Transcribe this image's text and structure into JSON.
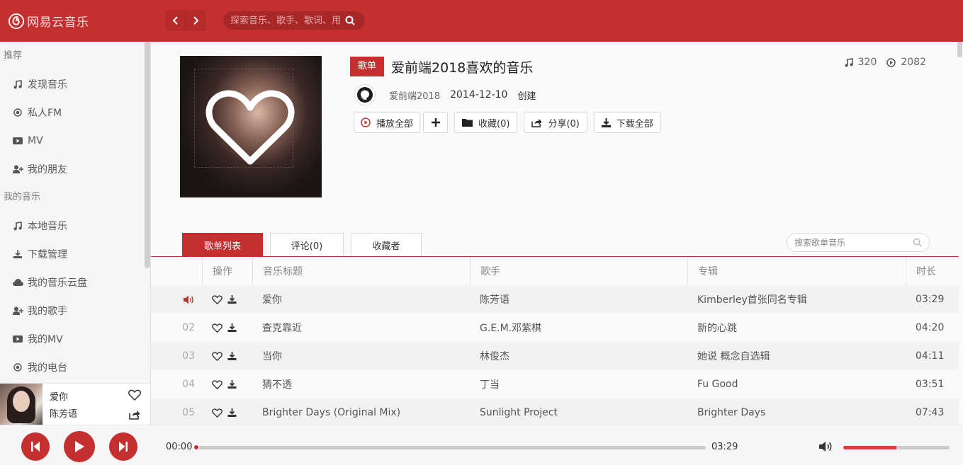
{
  "app": {
    "title": "网易云音乐",
    "brand_color": "#c62f2f"
  },
  "topbar": {
    "search_placeholder": "探索音乐、歌手、歌词、用"
  },
  "sidebar": {
    "sections": [
      {
        "title": "推荐",
        "items": [
          {
            "label": "发现音乐",
            "icon": "music-note-icon"
          },
          {
            "label": "私人FM",
            "icon": "radio-icon"
          },
          {
            "label": "MV",
            "icon": "video-icon"
          },
          {
            "label": "我的朋友",
            "icon": "add-friend-icon"
          }
        ]
      },
      {
        "title": "我的音乐",
        "items": [
          {
            "label": "本地音乐",
            "icon": "music-note-icon"
          },
          {
            "label": "下载管理",
            "icon": "download-icon"
          },
          {
            "label": "我的音乐云盘",
            "icon": "cloud-icon"
          },
          {
            "label": "我的歌手",
            "icon": "add-friend-icon"
          },
          {
            "label": "我的MV",
            "icon": "video-icon"
          },
          {
            "label": "我的电台",
            "icon": "radio-icon"
          }
        ]
      }
    ]
  },
  "mini_player": {
    "song": "爱你",
    "artist": "陈芳语"
  },
  "playlist": {
    "badge": "歌单",
    "title": "爱前端2018喜欢的音乐",
    "creator": "爱前端2018",
    "date": "2014-12-10",
    "created_label": "创建",
    "song_count": "320",
    "play_count": "2082",
    "actions": {
      "play_all": "播放全部",
      "collect": "收藏(0)",
      "share": "分享(0)",
      "download_all": "下载全部"
    }
  },
  "tabs": [
    {
      "label": "歌单列表",
      "active": true
    },
    {
      "label": "评论(0)",
      "active": false
    },
    {
      "label": "收藏者",
      "active": false
    }
  ],
  "playlist_search_placeholder": "搜索歌单音乐",
  "table": {
    "headers": [
      "操作",
      "音乐标题",
      "歌手",
      "专辑",
      "时长"
    ],
    "rows": [
      {
        "index": "",
        "playing": true,
        "title": "爱你",
        "artist": "陈芳语",
        "album": "Kimberley首张同名专辑",
        "duration": "03:29"
      },
      {
        "index": "02",
        "playing": false,
        "title": "查克靠近",
        "artist": "G.E.M.邓紫棋",
        "album": "新的心跳",
        "duration": "04:20"
      },
      {
        "index": "03",
        "playing": false,
        "title": "当你",
        "artist": "林俊杰",
        "album": "她说 概念自选辑",
        "duration": "04:11"
      },
      {
        "index": "04",
        "playing": false,
        "title": "猜不透",
        "artist": "丁当",
        "album": "Fu Good",
        "duration": "03:51"
      },
      {
        "index": "05",
        "playing": false,
        "title": "Brighter Days (Original Mix)",
        "artist": "Sunlight Project",
        "album": "Brighter Days",
        "duration": "07:43"
      }
    ]
  },
  "player": {
    "current_time": "00:00",
    "total_time": "03:29",
    "progress": 0,
    "volume": 0.5
  }
}
